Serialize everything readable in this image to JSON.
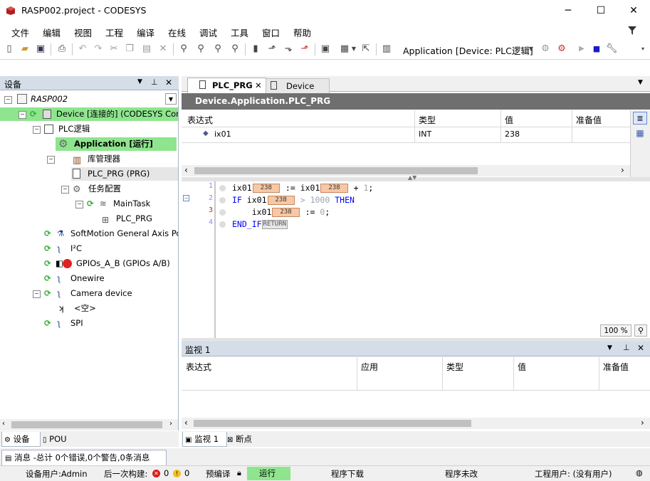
{
  "window": {
    "title": "RASP002.project - CODESYS",
    "minimize": "─",
    "maximize": "☐",
    "close": "✕"
  },
  "menu": [
    "文件",
    "编辑",
    "视图",
    "工程",
    "编译",
    "在线",
    "调试",
    "工具",
    "窗口",
    "帮助"
  ],
  "toolbar": {
    "app_selector": "Application [Device: PLC逻辑]"
  },
  "devices_panel": {
    "title": "设备",
    "tree": [
      {
        "label": "RASP002",
        "level": 0
      },
      {
        "label": "Device [连接的] (CODESYS Control",
        "level": 1
      },
      {
        "label": "PLC逻辑",
        "level": 2
      },
      {
        "label": "Application [运行]",
        "level": 3
      },
      {
        "label": "库管理器",
        "level": 4
      },
      {
        "label": "PLC_PRG (PRG)",
        "level": 4
      },
      {
        "label": "任务配置",
        "level": 4
      },
      {
        "label": "MainTask",
        "level": 5
      },
      {
        "label": "PLC_PRG",
        "level": 6
      },
      {
        "label": "SoftMotion General Axis Pool",
        "level": 2
      },
      {
        "label": "I²C",
        "level": 2
      },
      {
        "label": "GPIOs_A_B (GPIOs A/B)",
        "level": 2
      },
      {
        "label": "Onewire",
        "level": 2
      },
      {
        "label": "Camera device",
        "level": 2
      },
      {
        "label": "<空>",
        "level": 3
      },
      {
        "label": "SPI",
        "level": 2
      }
    ],
    "bottom_tabs": [
      "设备",
      "POU"
    ]
  },
  "editor": {
    "tabs": [
      "PLC_PRG",
      "Device"
    ],
    "path": "Device.Application.PLC_PRG",
    "columns": [
      "表达式",
      "类型",
      "值",
      "准备值"
    ],
    "rows": [
      {
        "expr": "ix01",
        "type": "INT",
        "value": "238",
        "prepared": ""
      }
    ],
    "code": {
      "line_numbers": [
        "1",
        "2",
        "3",
        "4"
      ],
      "var": "ix01",
      "val": "238",
      "assign": ":=",
      "plus": "+",
      "one": "1",
      "semi": ";",
      "if_kw": "IF",
      "gt": ">",
      "thousand": "1000",
      "then_kw": "THEN",
      "zero": "0",
      "endif_kw": "END_IF",
      "return_label": "RETURN"
    },
    "zoom": "100 %"
  },
  "watch_panel": {
    "title": "监视 1",
    "columns": [
      "表达式",
      "应用",
      "类型",
      "值",
      "准备值"
    ],
    "bottom_tabs": [
      "监视 1",
      "断点"
    ]
  },
  "messages_tab": "消息 -总计 0个错误,0个警告,0条消息",
  "statusbar": {
    "device_user": "设备用户:Admin",
    "last_build": "后一次构建:",
    "errors": "0",
    "warnings": "0",
    "precompile": "预编译",
    "run_state": "运行",
    "download": "程序下载",
    "changed": "程序未改",
    "project_user": "工程用户: (没有用户)"
  },
  "colors": {
    "panel_header": "#d4dde8",
    "running_green": "#8ee58e",
    "value_box": "#f6c8a6",
    "keyword": "#0000ff"
  }
}
